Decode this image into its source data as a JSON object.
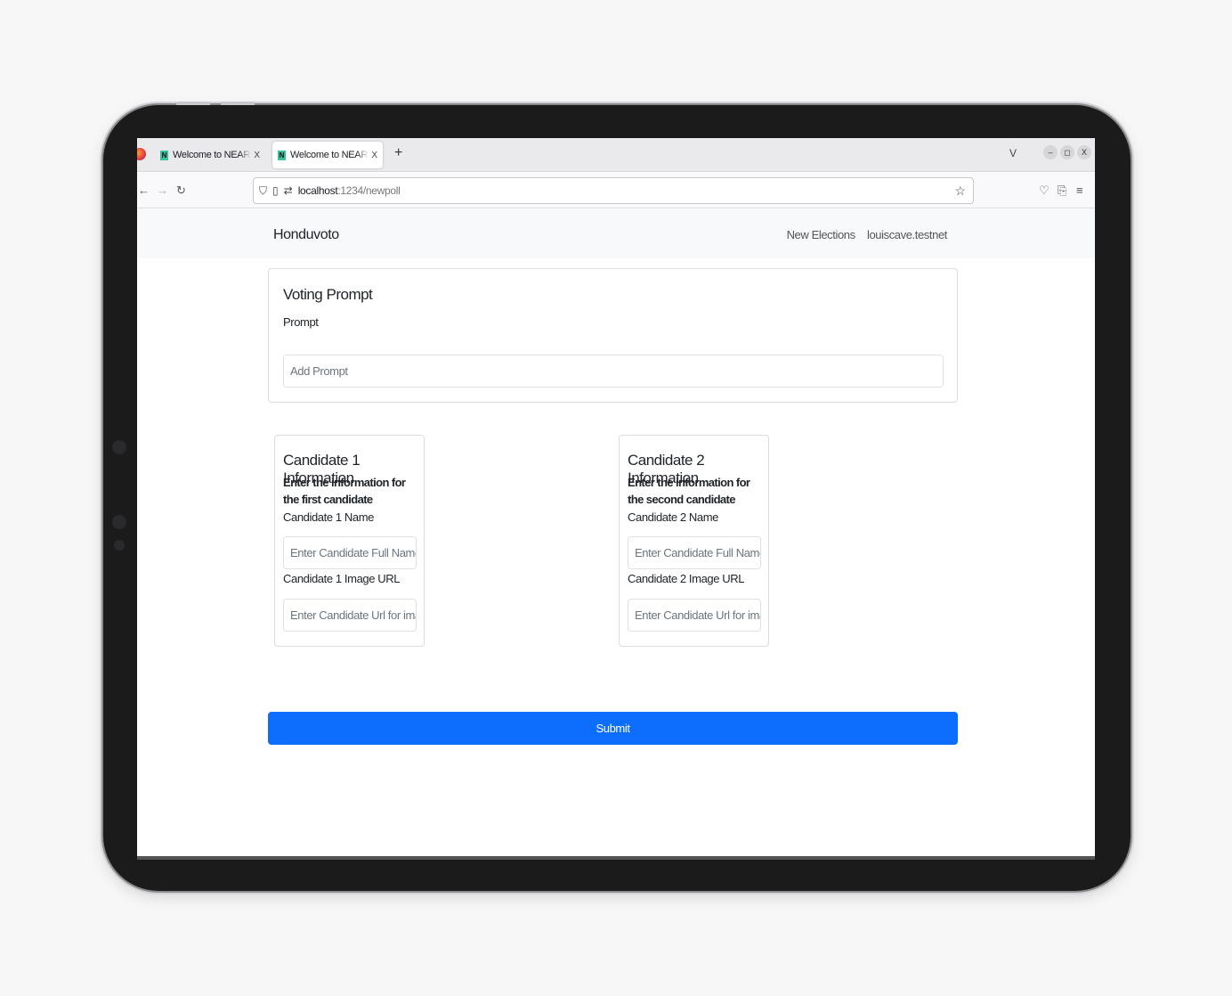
{
  "browser": {
    "tabs": [
      {
        "title": "Welcome to NEAR with React",
        "favicon": "N",
        "active": false
      },
      {
        "title": "Welcome to NEAR with React",
        "favicon": "N",
        "active": true
      }
    ],
    "tab_close": "X",
    "new_tab": "+",
    "tab_list": "V",
    "window_buttons": {
      "minimize": "–",
      "restore": "◻",
      "close": "X"
    },
    "url_host": "localhost",
    "url_path": ":1234/newpoll"
  },
  "header": {
    "brand": "Honduvoto",
    "links": [
      "New Elections",
      "louiscave.testnet"
    ]
  },
  "prompt_card": {
    "title": "Voting Prompt",
    "label": "Prompt",
    "placeholder": "Add Prompt"
  },
  "candidates": [
    {
      "title": "Candidate 1 Information",
      "description": "Enter the information for the first candidate",
      "name_label": "Candidate 1 Name",
      "name_placeholder": "Enter Candidate Full Name",
      "url_label": "Candidate 1 Image URL",
      "url_placeholder": "Enter Candidate Url for image"
    },
    {
      "title": "Candidate 2 Information",
      "description": "Enter the information for the second candidate",
      "name_label": "Candidate 2 Name",
      "name_placeholder": "Enter Candidate Full Name",
      "url_label": "Candidate 2 Image URL",
      "url_placeholder": "Enter Candidate Url for image"
    }
  ],
  "submit_label": "Submit",
  "colors": {
    "primary": "#0d6efd",
    "header_bg": "#f8f9fa"
  }
}
